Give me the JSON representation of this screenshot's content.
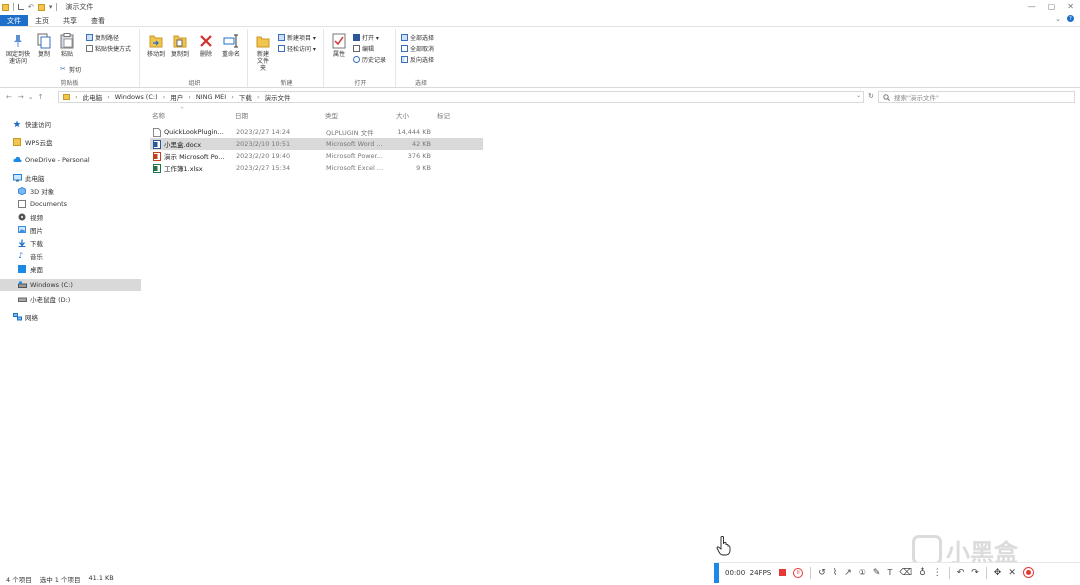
{
  "window": {
    "title": "演示文件",
    "minimize": "—",
    "maximize": "▢",
    "close": "✕"
  },
  "ribbon_tabs": [
    "文件",
    "主页",
    "共享",
    "查看"
  ],
  "ribbon_right": {
    "collapse": "⌄"
  },
  "ribbon": {
    "clipboard": {
      "label": "剪贴板",
      "pin": "固定到快速访问",
      "copy": "复制",
      "paste": "粘贴",
      "cut": "剪切",
      "copy_path": "复制路径",
      "paste_shortcut": "粘贴快捷方式"
    },
    "organize": {
      "label": "组织",
      "move_to": "移动到",
      "copy_to": "复制到",
      "delete": "删除",
      "rename": "重命名"
    },
    "new": {
      "label": "新建",
      "new_folder": "新建文件夹",
      "new_item": "新建项目 ▾",
      "easy_access": "轻松访问 ▾"
    },
    "open": {
      "label": "打开",
      "properties": "属性",
      "open": "打开 ▾",
      "edit": "编辑",
      "history": "历史记录"
    },
    "select": {
      "label": "选择",
      "select_all": "全部选择",
      "select_none": "全部取消",
      "invert": "反向选择"
    }
  },
  "nav": {
    "back": "←",
    "forward": "→",
    "recent": "⌄",
    "up": "↑",
    "breadcrumb": [
      "此电脑",
      "Windows (C:)",
      "用户",
      "NING MEI",
      "下载",
      "演示文件"
    ],
    "dropdown": "⌄",
    "refresh": "↻",
    "search_placeholder": "搜索\"演示文件\""
  },
  "sidebar": [
    {
      "label": "快速访问",
      "icon": "star-icon",
      "color": "#1e6fc9"
    },
    {
      "label": "WPS云盘",
      "icon": "folder-icon",
      "color": "#f2c450"
    },
    {
      "label": "OneDrive - Personal",
      "icon": "cloud-icon",
      "color": "#1e88e5"
    },
    {
      "label": "此电脑",
      "icon": "computer-icon",
      "color": "#1e88e5"
    },
    {
      "label": "3D 对象",
      "icon": "cube-icon",
      "color": "#3a8ee0"
    },
    {
      "label": "Documents",
      "icon": "document-icon",
      "color": "#7a7a7a"
    },
    {
      "label": "视频",
      "icon": "video-icon",
      "color": "#555"
    },
    {
      "label": "图片",
      "icon": "picture-icon",
      "color": "#3a8ee0"
    },
    {
      "label": "下载",
      "icon": "download-icon",
      "color": "#1e6fc9"
    },
    {
      "label": "音乐",
      "icon": "music-icon",
      "color": "#1e6fc9"
    },
    {
      "label": "桌面",
      "icon": "desktop-icon",
      "color": "#1e88e5"
    },
    {
      "label": "Windows (C:)",
      "icon": "drive-icon",
      "color": "#555"
    },
    {
      "label": "小老鼠盘 (D:)",
      "icon": "drive-icon",
      "color": "#666"
    },
    {
      "label": "网络",
      "icon": "network-icon",
      "color": "#1e6fc9"
    }
  ],
  "columns": [
    "名称",
    "日期",
    "类型",
    "大小",
    "标记"
  ],
  "files": [
    {
      "name": "QuickLookPlugin...",
      "date": "2023/2/27 14:24",
      "type": "QLPLUGIN 文件",
      "size": "14,444 KB",
      "icon": "file-icon",
      "color": "#888"
    },
    {
      "name": "小黑盒.docx",
      "date": "2023/2/10 10:51",
      "type": "Microsoft Word ...",
      "size": "42 KB",
      "icon": "word-icon",
      "color": "#2b579a"
    },
    {
      "name": "演示 Microsoft Po...",
      "date": "2023/2/20 19:40",
      "type": "Microsoft Power...",
      "size": "376 KB",
      "icon": "powerpoint-icon",
      "color": "#c43e1c"
    },
    {
      "name": "工作簿1.xlsx",
      "date": "2023/2/27 15:34",
      "type": "Microsoft Excel ...",
      "size": "9 KB",
      "icon": "excel-icon",
      "color": "#217346"
    }
  ],
  "status": {
    "count": "4 个项目",
    "selected": "选中 1 个项目",
    "size": "41.1 KB"
  },
  "recorder": {
    "time": "00:00",
    "fps": "24FPS",
    "pause": "II",
    "accent": "#1e88e5",
    "rec_color": "#e53935"
  },
  "watermark": {
    "text": "小黑盒"
  }
}
